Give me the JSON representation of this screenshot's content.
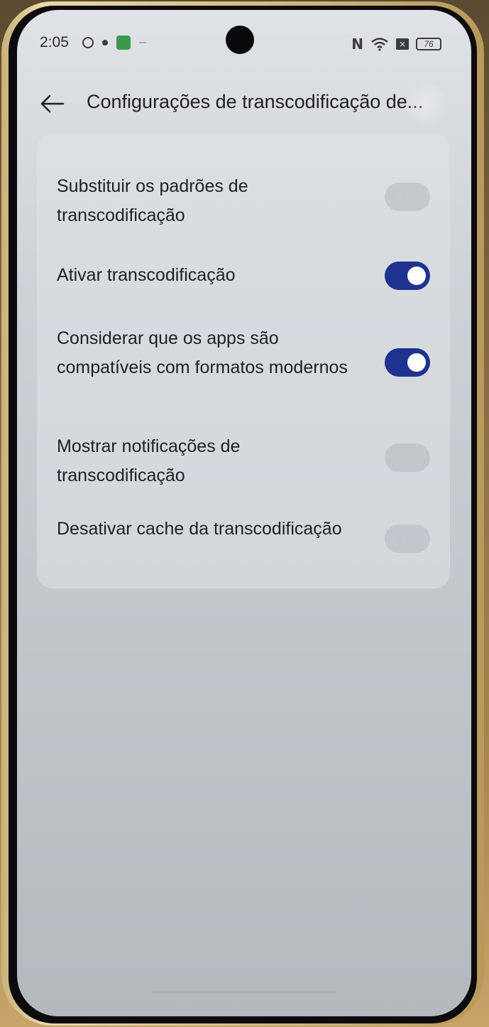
{
  "status_bar": {
    "time": "2:05",
    "battery": "76",
    "icons_left": [
      "circle-icon",
      "dot-icon",
      "green-app-icon",
      "dash-icon"
    ],
    "icons_right": [
      "nfc-icon",
      "wifi-icon",
      "sim-icon",
      "battery-icon"
    ]
  },
  "header": {
    "title": "Configurações de transcodificação de...",
    "back_icon": "arrow-left-icon"
  },
  "settings": [
    {
      "label": "Substituir os padrões de transcodificação",
      "enabled": false
    },
    {
      "label": "Ativar transcodificação",
      "enabled": true
    },
    {
      "label": "Considerar que os apps são compatíveis com formatos modernos",
      "enabled": true
    },
    {
      "label": "Mostrar notificações de transcodificação",
      "enabled": false
    },
    {
      "label": "Desativar cache da transcodificação",
      "enabled": false
    }
  ],
  "colors": {
    "toggle_on": "#1f3290",
    "toggle_off": "#b4b8be",
    "text": "#1e2024"
  }
}
